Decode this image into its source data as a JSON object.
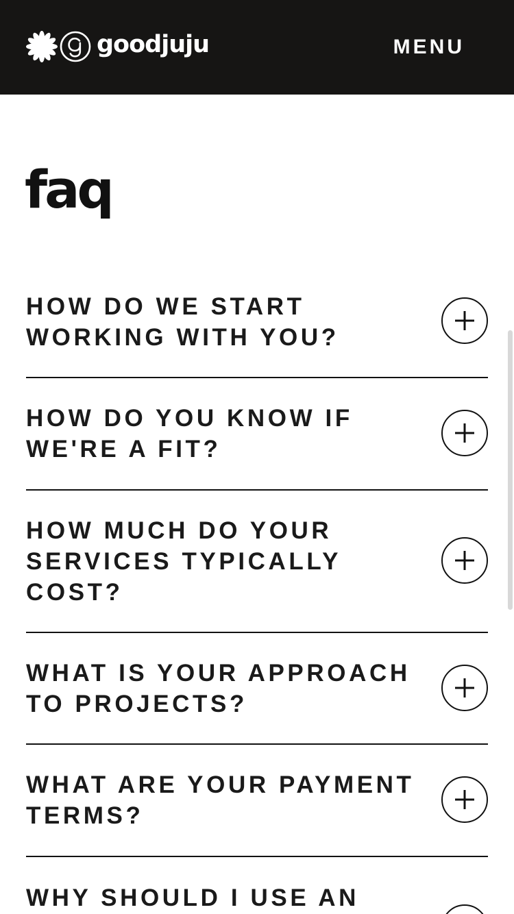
{
  "header": {
    "brand": "goodjuju",
    "menu_label": "MENU"
  },
  "page": {
    "title": "faq"
  },
  "faq": [
    {
      "question": "HOW DO WE START WORKING WITH YOU?"
    },
    {
      "question": "HOW DO YOU KNOW IF WE'RE A FIT?"
    },
    {
      "question": "HOW MUCH DO YOUR SERVICES TYPICALLY COST?"
    },
    {
      "question": "WHAT IS YOUR APPROACH TO PROJECTS?"
    },
    {
      "question": "WHAT ARE YOUR PAYMENT TERMS?"
    },
    {
      "question": "WHY SHOULD I USE AN"
    }
  ],
  "icons": {
    "logo_flower": "flower-icon",
    "logo_monogram": "g-monogram-icon",
    "toggle": "plus-icon"
  },
  "colors": {
    "header_bg": "#161514",
    "text": "#111111",
    "background": "#ffffff"
  }
}
